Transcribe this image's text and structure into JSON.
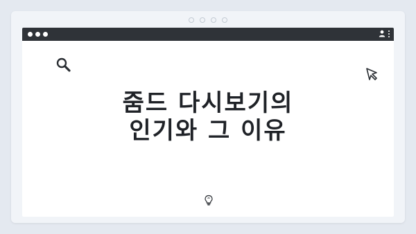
{
  "window": {
    "controls": [
      "close-dot",
      "minimize-dot",
      "maximize-dot"
    ]
  },
  "toolbar": {
    "left_icon": "search-icon",
    "right_icon": "cursor-icon",
    "profile_icon": "user-icon",
    "menu_icon": "kebab-menu-icon"
  },
  "main": {
    "title_line1": "줌드 다시보기의",
    "title_line2": "인기와 그 이유",
    "footer_icon": "lightbulb-icon"
  },
  "colors": {
    "titlebar": "#2f3338",
    "page_bg": "#e4e9f0",
    "card_bg": "#ffffff",
    "text": "#1f2227"
  }
}
